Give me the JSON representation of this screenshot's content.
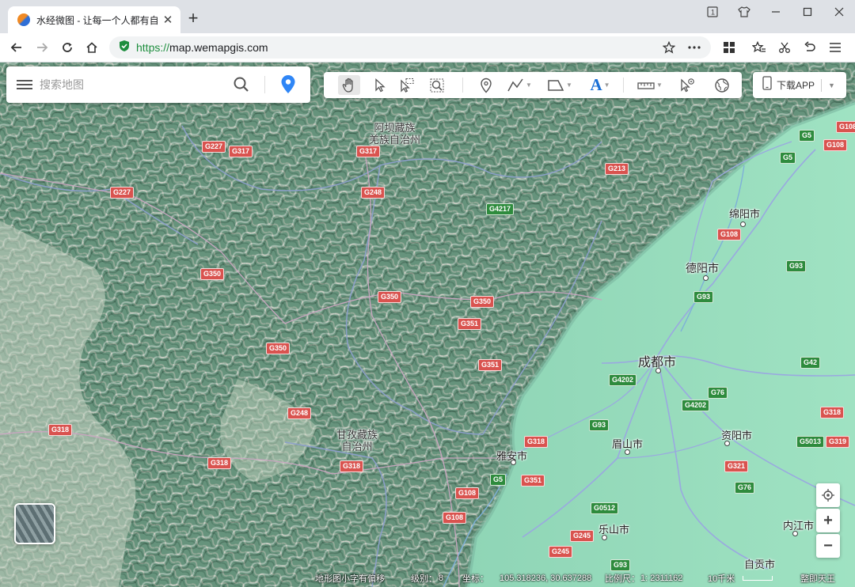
{
  "browser": {
    "tab_title": "水经微图 - 让每一个人都有自",
    "url_scheme": "https://",
    "url_host": "map.wemapgis.com",
    "icons": [
      "favicon-icon",
      "close-icon",
      "plus-icon",
      "tab-list-icon",
      "shirt-icon",
      "minimize-icon",
      "maximize-icon",
      "close-icon",
      "back-icon",
      "forward-icon",
      "reload-icon",
      "home-icon",
      "shield-check-icon",
      "star-icon",
      "more-icon",
      "apps-icon",
      "favorites-icon",
      "scissors-icon",
      "undo-icon",
      "menu-icon"
    ]
  },
  "search": {
    "placeholder": "搜索地图"
  },
  "toolbar": {
    "tools": [
      "hand-icon",
      "pointer-icon",
      "select-box-icon",
      "zoom-box-icon",
      "marker-icon",
      "polyline-icon",
      "polygon-icon",
      "text-icon",
      "ruler-icon",
      "poi-query-icon",
      "globe-icon"
    ]
  },
  "download": {
    "label": "下载APP"
  },
  "map": {
    "places": {
      "aba": "阿坝藏族\n羌族自治州",
      "ganzi": "甘孜藏族\n自治州",
      "mianyang": "绵阳市",
      "deyang": "德阳市",
      "chengdu": "成都市",
      "meishan": "眉山市",
      "ziyang": "资阳市",
      "yaan": "雅安市",
      "leshan": "乐山市",
      "neijiang": "内江市",
      "zigong": "自贡市"
    },
    "roads": {
      "g227a": "G227",
      "g317a": "G317",
      "g317b": "G317",
      "g227b": "G227",
      "g248a": "G248",
      "g4217": "G4217",
      "g213": "G213",
      "g108a": "G108",
      "g5a": "G5",
      "g5b": "G5",
      "g108b": "G108",
      "g108c": "G108",
      "g350a": "G350",
      "g350b": "G350",
      "g350c": "G350",
      "g351a": "G351",
      "g93a": "G93",
      "g93b": "G93",
      "g350d": "G350",
      "g351b": "G351",
      "g4202a": "G4202",
      "g76a": "G76",
      "g42": "G42",
      "g4202b": "G4202",
      "g248b": "G248",
      "g318a": "G318",
      "g93c": "G93",
      "g318b": "G318",
      "g318c": "G318",
      "g318d": "G318",
      "g318e": "G318",
      "g5013": "G5013",
      "g319": "G319",
      "g5c": "G5",
      "g351c": "G351",
      "g321": "G321",
      "g108d": "G108",
      "g76b": "G76",
      "g0512": "G0512",
      "g108e": "G108",
      "g245a": "G245",
      "g245b": "G245",
      "g93d": "G93"
    }
  },
  "status": {
    "watermark": "地形图小字有偏移",
    "level_label": "级别：",
    "level_value": "8",
    "coord_label": "坐标：",
    "coord_value": "105.318236, 30.637288",
    "scale_label": "比例尺：",
    "scale_value": "1: 2311162",
    "scale_bar": "10千米",
    "provider": "整即天王"
  },
  "colors": {
    "highway_red": "#d9534f",
    "expressway_green": "#2e8b3d",
    "location_blue": "#2f86f6"
  }
}
